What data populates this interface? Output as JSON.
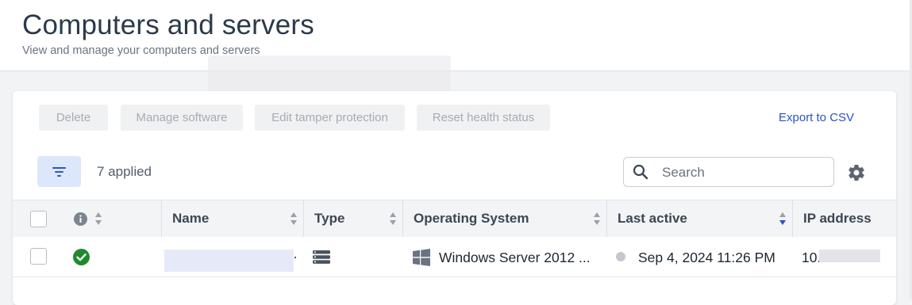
{
  "header": {
    "title": "Computers and servers",
    "subtitle": "View and manage your computers and servers"
  },
  "toolbar": {
    "delete_label": "Delete",
    "manage_software_label": "Manage software",
    "edit_tamper_label": "Edit tamper protection",
    "reset_health_label": "Reset health status",
    "export_label": "Export to CSV"
  },
  "filters": {
    "applied_text": "7 applied"
  },
  "search": {
    "placeholder": "Search"
  },
  "table": {
    "columns": {
      "name": "Name",
      "type": "Type",
      "os": "Operating System",
      "last_active": "Last active",
      "ip": "IP address"
    },
    "rows": [
      {
        "status_icon": "check-circle-icon",
        "name": "",
        "type_icon": "server-icon",
        "os_icon": "windows-icon",
        "os": "Windows Server 2012 ...",
        "last_active": "Sep 4, 2024 11:26 PM",
        "ip": "10."
      }
    ]
  },
  "colors": {
    "accent": "#2b52c9",
    "status_ok": "#1f8a2e",
    "filter_bg": "#dde7fb"
  }
}
